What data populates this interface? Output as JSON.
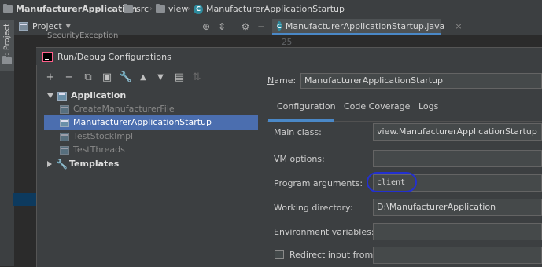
{
  "breadcrumb": {
    "project": "ManufacturerApplication",
    "folder1": "src",
    "folder2": "view",
    "file": "ManufacturerApplicationStartup"
  },
  "tool_window": {
    "stripe_label": "1: Project",
    "header_label": "Project",
    "background_item": "SecurityException"
  },
  "editor": {
    "tab_label": "ManufacturerApplicationStartup.java",
    "line_number": "25"
  },
  "dialog": {
    "title": "Run/Debug Configurations",
    "tree": {
      "application_label": "Application",
      "items": [
        "CreateManufacturerFile",
        "ManufacturerApplicationStartup",
        "TestStockImpl",
        "TestThreads"
      ],
      "templates_label": "Templates"
    },
    "name_label": "Name:",
    "name_value": "ManufacturerApplicationStartup",
    "tabs": [
      "Configuration",
      "Code Coverage",
      "Logs"
    ],
    "form": {
      "main_class_label": "Main class:",
      "main_class_value": "view.ManufacturerApplicationStartup",
      "vm_options_label": "VM options:",
      "vm_options_value": "",
      "program_args_label": "Program arguments:",
      "program_args_value": "client",
      "working_dir_label": "Working directory:",
      "working_dir_value": "D:\\ManufacturerApplication",
      "env_vars_label": "Environment variables:",
      "env_vars_value": "",
      "redirect_label": "Redirect input from:",
      "redirect_value": ""
    }
  },
  "colors": {
    "selection": "#4b6eaf",
    "highlight_circle": "#2330d0",
    "accent": "#4a88c7"
  }
}
